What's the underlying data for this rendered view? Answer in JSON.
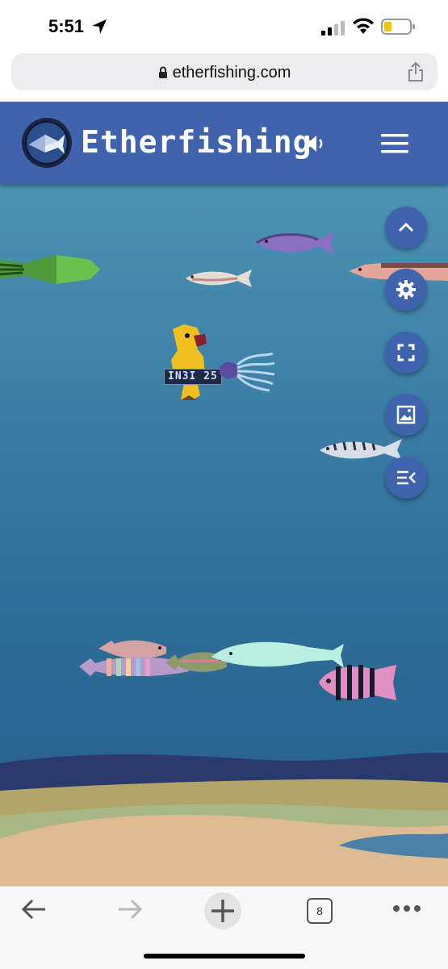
{
  "status_bar": {
    "time": "5:51"
  },
  "browser": {
    "url": "etherfishing.com",
    "tab_count": "8"
  },
  "site": {
    "name": "Etherfishing"
  },
  "player": {
    "tag": "IN3I 25"
  },
  "icons": {
    "logo": "etherfishing-logo",
    "sound": "speaker-icon",
    "menu": "hamburger-menu-icon",
    "fab_buttons": [
      "chevron-up-icon",
      "gear-icon",
      "fullscreen-icon",
      "picture-icon",
      "playlist-icon"
    ]
  },
  "colors": {
    "header": "#3f63ad",
    "water_top": "#4b93b4",
    "water_bottom": "#2a6493"
  }
}
